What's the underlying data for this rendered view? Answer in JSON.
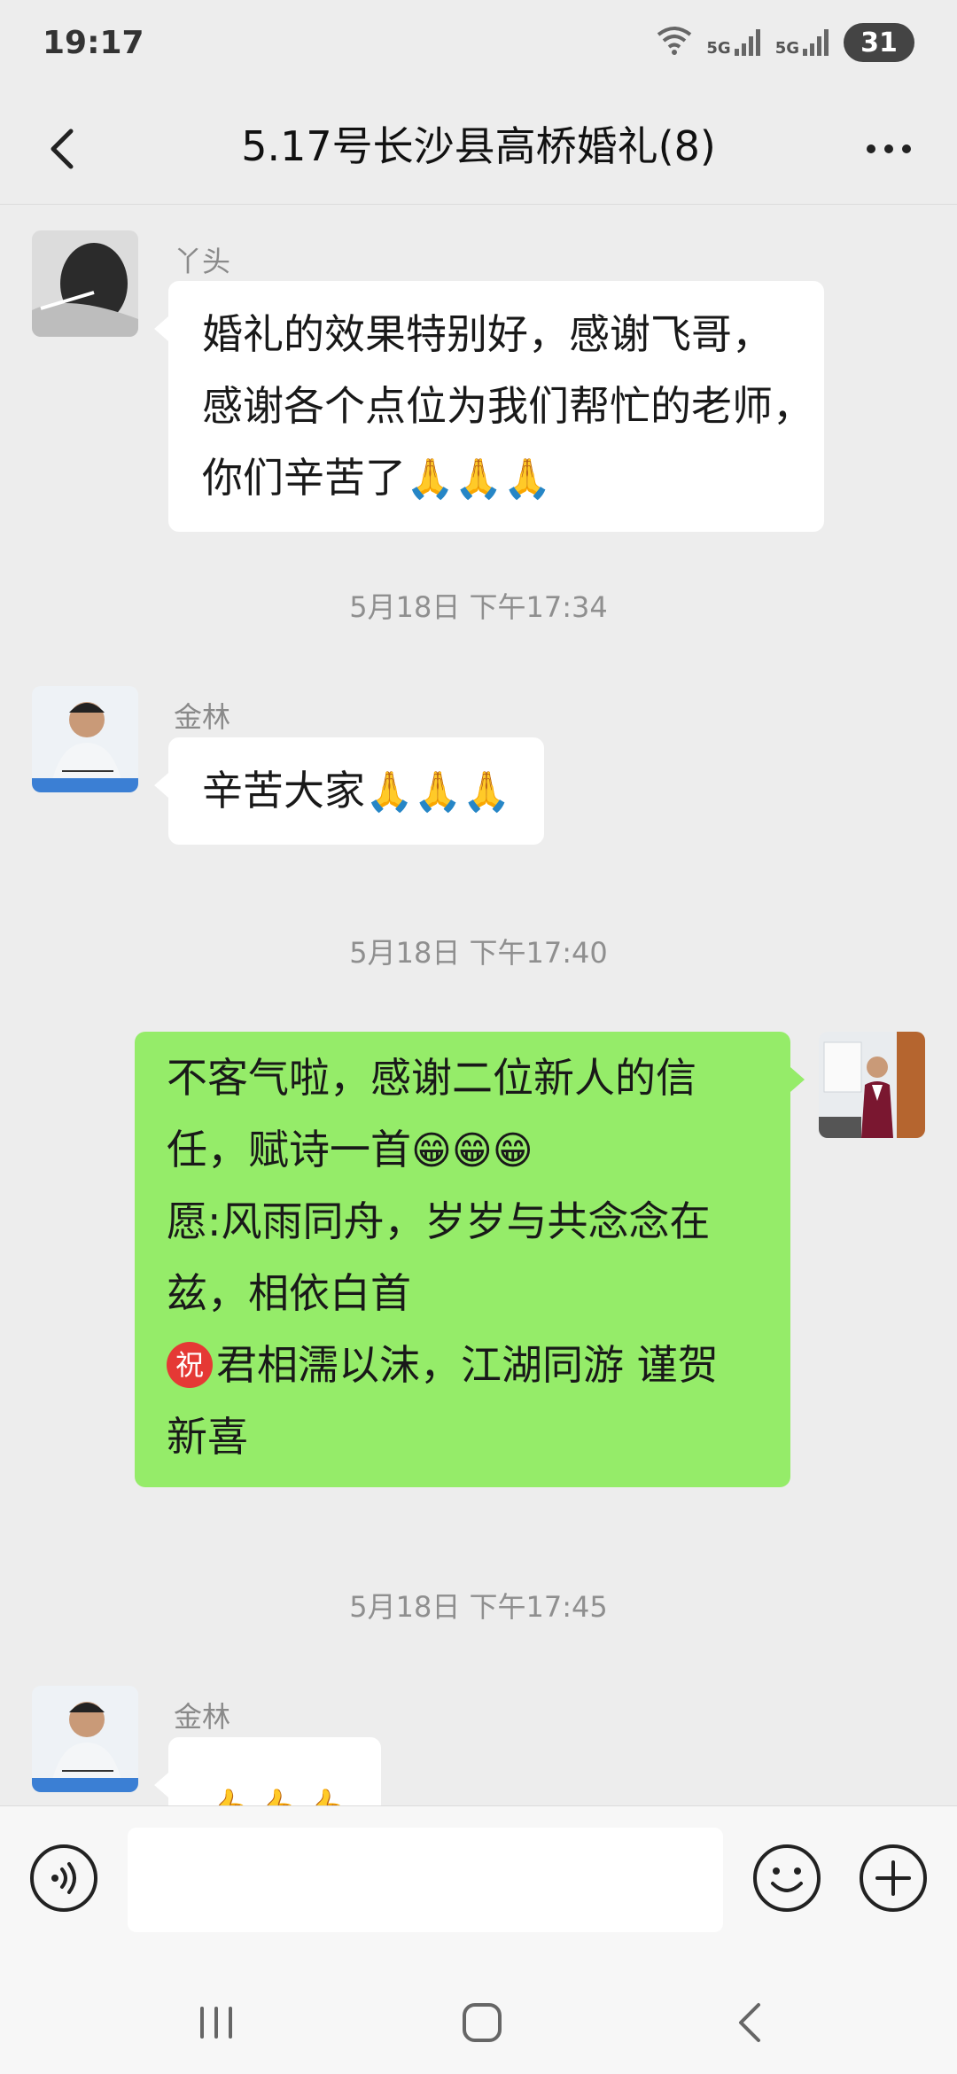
{
  "status_bar": {
    "time": "19:17",
    "signal_labels": [
      "5G",
      "5G"
    ],
    "battery": "31"
  },
  "chat_header": {
    "title": "5.17号长沙县高桥婚礼(8)"
  },
  "messages": [
    {
      "sender": "丫头",
      "lines": [
        "婚礼的效果特别好，感谢飞哥，",
        "感谢各个点位为我们帮忙的老师，",
        "你们辛苦了"
      ],
      "emoji": "🙏🙏🙏"
    },
    {
      "timestamp": "5月18日 下午17:34"
    },
    {
      "sender": "金林",
      "lines": [
        "辛苦大家"
      ],
      "emoji": "🙏🙏🙏"
    },
    {
      "timestamp": "5月18日 下午17:40"
    },
    {
      "sender": "me",
      "lines": [
        "不客气啦，感谢二位新人的信",
        "任，赋诗一首",
        "愿:风雨同舟，岁岁与共念念在",
        "兹，相依白首",
        "君相濡以沫，江湖同游 谨贺",
        "新喜"
      ],
      "emoji": "😁😁😁",
      "badge": "祝"
    },
    {
      "timestamp": "5月18日 下午17:45"
    },
    {
      "sender": "金林",
      "emoji": "👍👍👍"
    }
  ],
  "input_bar": {
    "icons": [
      "voice-icon",
      "emoji-icon",
      "plus-icon"
    ],
    "text": ""
  },
  "system_nav": {
    "icons": [
      "recents-icon",
      "home-icon",
      "back-icon"
    ]
  },
  "colors": {
    "background": "#ededed",
    "incoming_bubble": "#ffffff",
    "outgoing_bubble": "#95ec69",
    "timestamp_text": "#8f8f8f"
  }
}
